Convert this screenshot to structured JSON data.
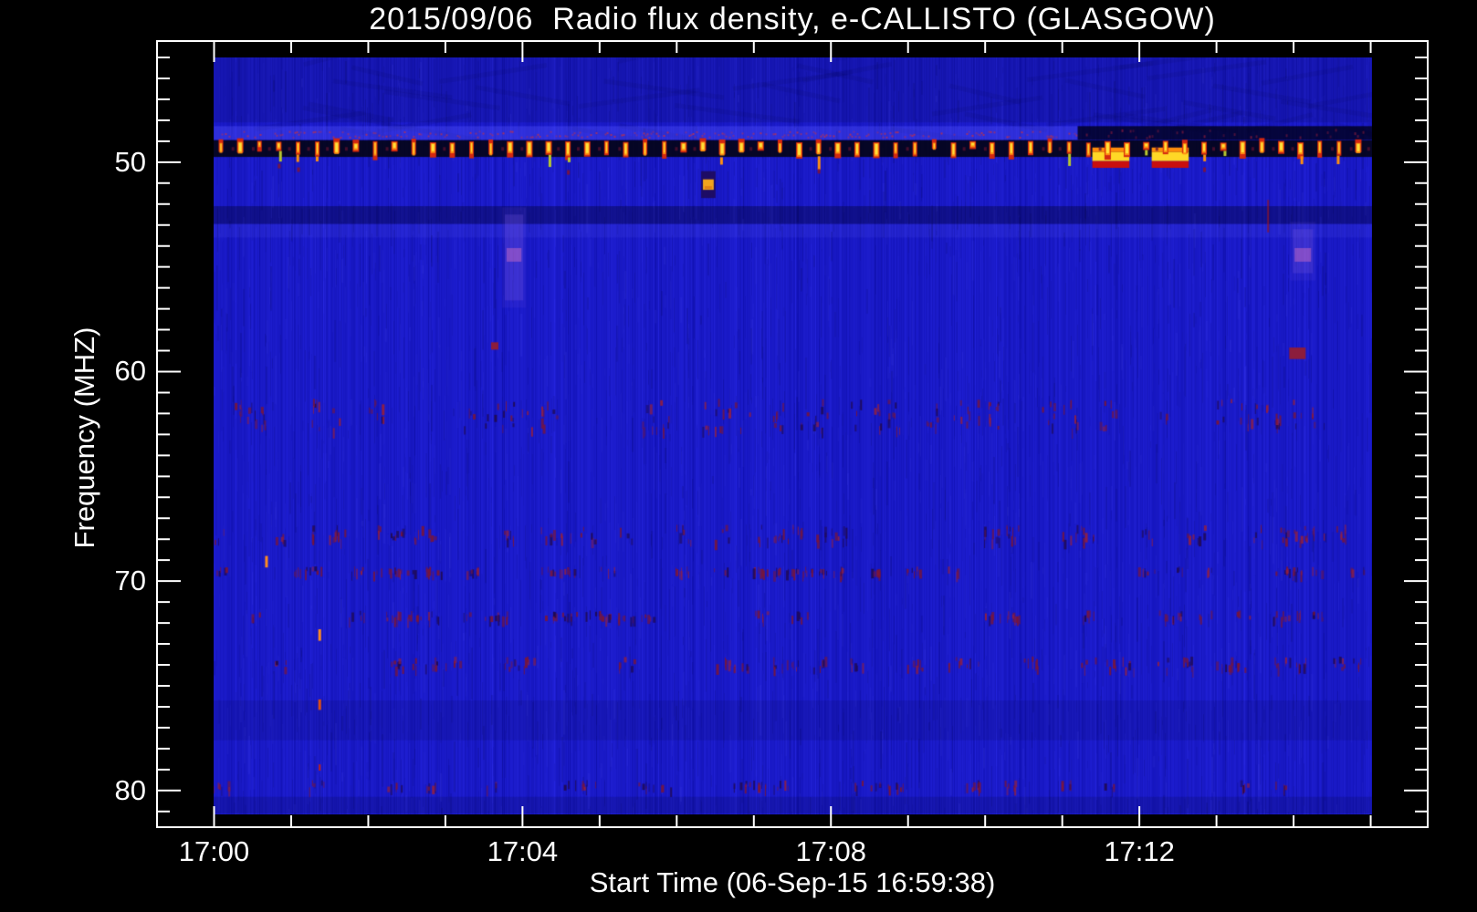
{
  "title": "2015/09/06  Radio flux density, e-CALLISTO (GLASGOW)",
  "x_axis": {
    "label": "Start Time (06-Sep-15 16:59:38)"
  },
  "y_axis": {
    "label": "Frequency (MHZ)"
  },
  "chart_data": {
    "type": "heatmap",
    "subtype": "radio-spectrogram",
    "title": "2015/09/06  Radio flux density, e-CALLISTO (GLASGOW)",
    "station": "GLASGOW",
    "network": "e-CALLISTO",
    "date_label": "2015/09/06",
    "xlabel": "Start Time (06-Sep-15 16:59:38)",
    "ylabel": "Frequency (MHZ)",
    "x": {
      "unit": "minutes after 17:00",
      "range": [
        -0.01,
        15.02
      ],
      "minor_step_min": 1,
      "minor_range": [
        0,
        15
      ],
      "majors": [
        {
          "t": 0,
          "label": "17:00"
        },
        {
          "t": 4,
          "label": "17:04"
        },
        {
          "t": 8,
          "label": "17:08"
        },
        {
          "t": 12,
          "label": "17:12"
        }
      ]
    },
    "y": {
      "unit": "MHz",
      "range": [
        45.0,
        81.1
      ],
      "minor_step_mhz": 1,
      "minor_range": [
        45,
        81
      ],
      "majors": [
        {
          "f": 50,
          "label": "50"
        },
        {
          "f": 60,
          "label": "60"
        },
        {
          "f": 70,
          "label": "70"
        },
        {
          "f": 80,
          "label": "80"
        }
      ]
    },
    "colormap": {
      "background": "#1717d2",
      "column_dark": [
        11,
        11,
        166
      ],
      "column_light": [
        41,
        41,
        233
      ],
      "rfi_red": "#d42810",
      "rfi_orange": "#ff9010",
      "rfi_yellow": "#ffe23c",
      "rfi_tail_green": "#b8c830",
      "speckle_maroon": "#7a1638",
      "speckle_maroon_bright": "#93203f",
      "speckle_indigo": "#200a52",
      "band_speckle_red": "#b43055",
      "segment_yellow": "#ffd826",
      "segment_red": "#c80f0f",
      "segment_orange": "#ff8c0c",
      "blob_orange": "#f2a41c",
      "blob_halo": "#1e0a55",
      "smudge_purple": "rgba(115,85,220,0.28)",
      "smudge_pink": "rgba(200,105,195,0.50)"
    },
    "features": {
      "carrier_dash_line": {
        "freq_mhz": [
          48.95,
          49.75
        ],
        "dash_period_s": 15,
        "first_dash_t_min": 0.089,
        "dash_count": 60
      },
      "light_band": {
        "freq_mhz": [
          48.28,
          48.93
        ],
        "t_min": [
          0,
          11.2
        ],
        "speckle_freq_mhz": [
          48.5,
          48.8
        ]
      },
      "dark_band_right": {
        "freq_mhz": [
          48.28,
          48.93
        ],
        "t_min": [
          11.2,
          15.02
        ]
      },
      "bright_segments": [
        {
          "t_min": [
            11.39,
            11.87
          ],
          "freq_mhz": [
            49.3,
            50.27
          ]
        },
        {
          "t_min": [
            12.16,
            12.64
          ],
          "freq_mhz": [
            49.3,
            50.27
          ]
        }
      ],
      "point_burst": {
        "t_min": [
          6.34,
          6.48
        ],
        "freq_mhz": [
          50.82,
          51.32
        ]
      },
      "shade_bands": [
        {
          "freq_mhz": [
            45.0,
            48.1
          ],
          "alpha": 0.13,
          "tone": "dark"
        },
        {
          "freq_mhz": [
            52.1,
            52.95
          ],
          "alpha": 0.35,
          "tone": "dark"
        },
        {
          "freq_mhz": [
            52.95,
            53.6
          ],
          "alpha": 0.12,
          "tone": "light"
        },
        {
          "freq_mhz": [
            75.7,
            77.6
          ],
          "alpha": 0.1,
          "tone": "dark"
        },
        {
          "freq_mhz": [
            80.3,
            81.1
          ],
          "alpha": 0.15,
          "tone": "dark"
        }
      ],
      "speckle_bands": [
        {
          "freq_mhz": [
            61.3,
            63.1
          ],
          "density": 0.6
        },
        {
          "freq_mhz": [
            67.3,
            68.4
          ],
          "density": 0.55
        },
        {
          "freq_mhz": [
            69.3,
            69.9
          ],
          "density": 0.4
        },
        {
          "freq_mhz": [
            71.4,
            72.1
          ],
          "density": 0.5
        },
        {
          "freq_mhz": [
            73.6,
            74.5
          ],
          "density": 0.5
        },
        {
          "freq_mhz": [
            79.5,
            80.2
          ],
          "density": 0.15
        }
      ],
      "smudges": [
        {
          "t_min": [
            3.77,
            4.01
          ],
          "freq_mhz": [
            52.5,
            56.6
          ],
          "core_freq_mhz": [
            54.1,
            54.75
          ]
        },
        {
          "t_min": [
            13.99,
            14.25
          ],
          "freq_mhz": [
            53.2,
            55.3
          ],
          "core_freq_mhz": [
            54.1,
            54.75
          ]
        }
      ],
      "events": [
        {
          "t_min": 0.68,
          "freq_mhz": [
            68.8,
            69.35
          ],
          "color": "#ff8c20",
          "w": 3
        },
        {
          "t_min": 1.37,
          "freq_mhz": [
            72.3,
            72.85
          ],
          "color": "#ff8c20",
          "w": 3
        },
        {
          "t_min": 1.37,
          "freq_mhz": [
            75.65,
            76.15
          ],
          "color": "#e05010",
          "w": 3
        },
        {
          "t_min": 1.37,
          "freq_mhz": [
            78.75,
            79.05
          ],
          "color": "#c02015",
          "w": 2
        },
        {
          "t_min": 3.64,
          "freq_mhz": [
            58.6,
            58.95
          ],
          "color": "#8c1d3c",
          "w": 8
        },
        {
          "t_min": 13.67,
          "freq_mhz": [
            51.8,
            53.35
          ],
          "color": "rgba(150,20,30,0.7)",
          "w": 2
        },
        {
          "t_min": 14.05,
          "freq_mhz": [
            58.85,
            59.4
          ],
          "color": "#8c1d3c",
          "w": 18
        }
      ]
    }
  }
}
